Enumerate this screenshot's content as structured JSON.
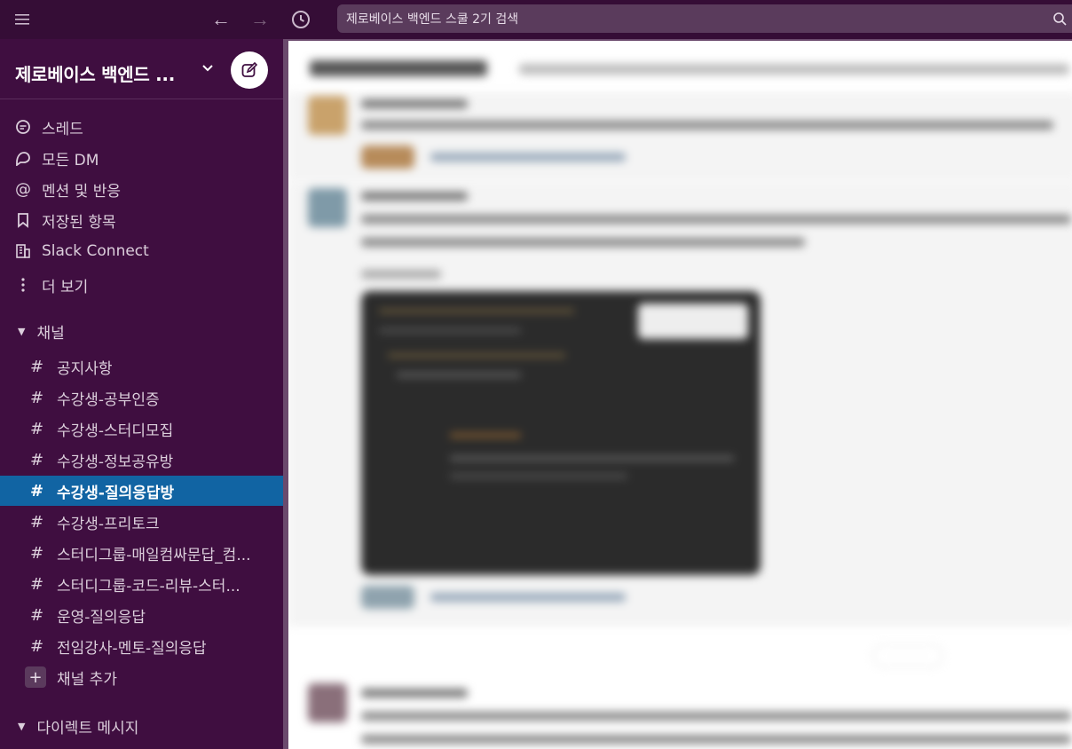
{
  "topbar": {
    "search_placeholder": "제로베이스 백엔드 스쿨 2기 검색"
  },
  "workspace": {
    "name": "제로베이스 백엔드 ..."
  },
  "nav": [
    {
      "label": "스레드",
      "icon": "threads-icon"
    },
    {
      "label": "모든 DM",
      "icon": "dm-icon"
    },
    {
      "label": "멘션 및 반응",
      "icon": "mention-icon"
    },
    {
      "label": "저장된 항목",
      "icon": "bookmark-icon"
    },
    {
      "label": "Slack Connect",
      "icon": "building-icon"
    },
    {
      "label": "더 보기",
      "icon": "more-vertical-icon"
    }
  ],
  "channels_section": {
    "title": "채널",
    "items": [
      {
        "label": "공지사항",
        "active": false
      },
      {
        "label": "수강생-공부인증",
        "active": false
      },
      {
        "label": "수강생-스터디모집",
        "active": false
      },
      {
        "label": "수강생-정보공유방",
        "active": false
      },
      {
        "label": "수강생-질의응답방",
        "active": true
      },
      {
        "label": "수강생-프리토크",
        "active": false
      },
      {
        "label": "스터디그룹-매일컴싸문답_컴...",
        "active": false
      },
      {
        "label": "스터디그룹-코드-리뷰-스터...",
        "active": false
      },
      {
        "label": "운영-질의응답",
        "active": false
      },
      {
        "label": "전임강사-멘토-질의응답",
        "active": false
      }
    ],
    "add_label": "채널 추가"
  },
  "dm_section": {
    "title": "다이렉트 메시지"
  },
  "colors": {
    "sidebar_bg": "#3f0e40",
    "topbar_bg": "#350d36",
    "active_channel": "#1164a3"
  }
}
